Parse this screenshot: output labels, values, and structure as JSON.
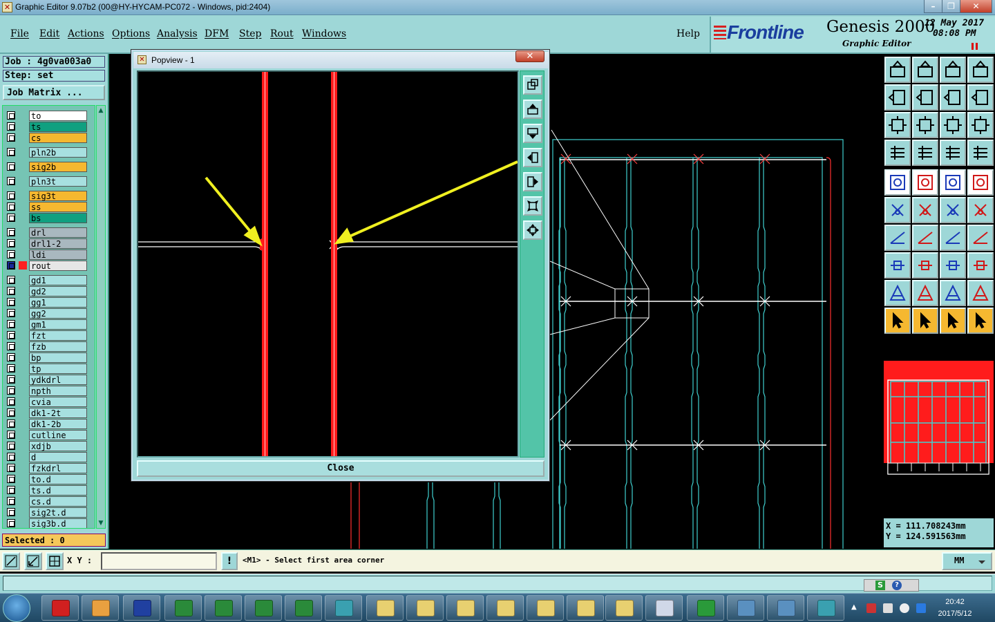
{
  "window": {
    "title": "Graphic Editor 9.07b2 (00@HY-HYCAM-PC072 - Windows, pid:2404)",
    "minimize_glyph": "–",
    "restore_glyph": "❐",
    "close_glyph": "✕"
  },
  "menu": {
    "items": [
      "File",
      "Edit",
      "Actions",
      "Options",
      "Analysis",
      "DFM",
      "Step",
      "Rout",
      "Windows"
    ],
    "help": "Help"
  },
  "brand": {
    "logo": "Frontline",
    "product": "Genesis 2000",
    "subtitle": "Graphic Editor",
    "date": "12 May 2017",
    "time": "08:08 PM"
  },
  "job": {
    "job_label": "Job : 4g0va003a0",
    "step_label": "Step: set",
    "matrix_button": "Job Matrix ..."
  },
  "layers": [
    {
      "name": "to",
      "color": "#ffffff"
    },
    {
      "name": "ts",
      "color": "#10a080"
    },
    {
      "name": "cs",
      "color": "#f5b830"
    },
    {
      "name": "pln2b",
      "color": "#a7e0e0"
    },
    {
      "name": "sig2b",
      "color": "#f5b830"
    },
    {
      "name": "pln3t",
      "color": "#a7e0e0"
    },
    {
      "name": "sig3t",
      "color": "#f5b830"
    },
    {
      "name": "ss",
      "color": "#f5b830"
    },
    {
      "name": "bs",
      "color": "#10a080"
    },
    {
      "name": "drl",
      "color": "#a9b8bf"
    },
    {
      "name": "drl1-2",
      "color": "#a9b8bf"
    },
    {
      "name": "ldi",
      "color": "#a9b8bf"
    },
    {
      "name": "rout",
      "color": "#e6e6e6"
    },
    {
      "name": "gd1",
      "color": "#a7e0e0"
    },
    {
      "name": "gd2",
      "color": "#a7e0e0"
    },
    {
      "name": "gg1",
      "color": "#a7e0e0"
    },
    {
      "name": "gg2",
      "color": "#a7e0e0"
    },
    {
      "name": "gm1",
      "color": "#a7e0e0"
    },
    {
      "name": "fzt",
      "color": "#a7e0e0"
    },
    {
      "name": "fzb",
      "color": "#a7e0e0"
    },
    {
      "name": "bp",
      "color": "#a7e0e0"
    },
    {
      "name": "tp",
      "color": "#a7e0e0"
    },
    {
      "name": "ydkdrl",
      "color": "#a7e0e0"
    },
    {
      "name": "npth",
      "color": "#a7e0e0"
    },
    {
      "name": "cvia",
      "color": "#a7e0e0"
    },
    {
      "name": "dk1-2t",
      "color": "#a7e0e0"
    },
    {
      "name": "dk1-2b",
      "color": "#a7e0e0"
    },
    {
      "name": "cutline",
      "color": "#a7e0e0"
    },
    {
      "name": "xdjb",
      "color": "#a7e0e0"
    },
    {
      "name": "d",
      "color": "#a7e0e0"
    },
    {
      "name": "fzkdrl",
      "color": "#a7e0e0"
    },
    {
      "name": "to.d",
      "color": "#a7e0e0"
    },
    {
      "name": "ts.d",
      "color": "#a7e0e0"
    },
    {
      "name": "cs.d",
      "color": "#a7e0e0"
    },
    {
      "name": "sig2t.d",
      "color": "#a7e0e0"
    },
    {
      "name": "sig3b.d",
      "color": "#a7e0e0"
    }
  ],
  "selected": "Selected : 0",
  "popview": {
    "title": "Popview - 1",
    "close_glyph": "✕",
    "close_button": "Close"
  },
  "coords": {
    "x": "X  =  111.708243mm",
    "y": "Y  =  124.591563mm"
  },
  "command": {
    "xy_label": "X Y :",
    "xy_value": "",
    "warn_glyph": "!",
    "prompt": "<M1> - Select first area corner",
    "units": "MM"
  },
  "taskbar": {
    "time": "20:42",
    "date": "2017/5/12"
  },
  "colors": {
    "panel": "#9ed7d7",
    "rout_red": "#ff2020",
    "annotation_arrow": "#f0f020",
    "board_outline": "#40d0d0"
  }
}
